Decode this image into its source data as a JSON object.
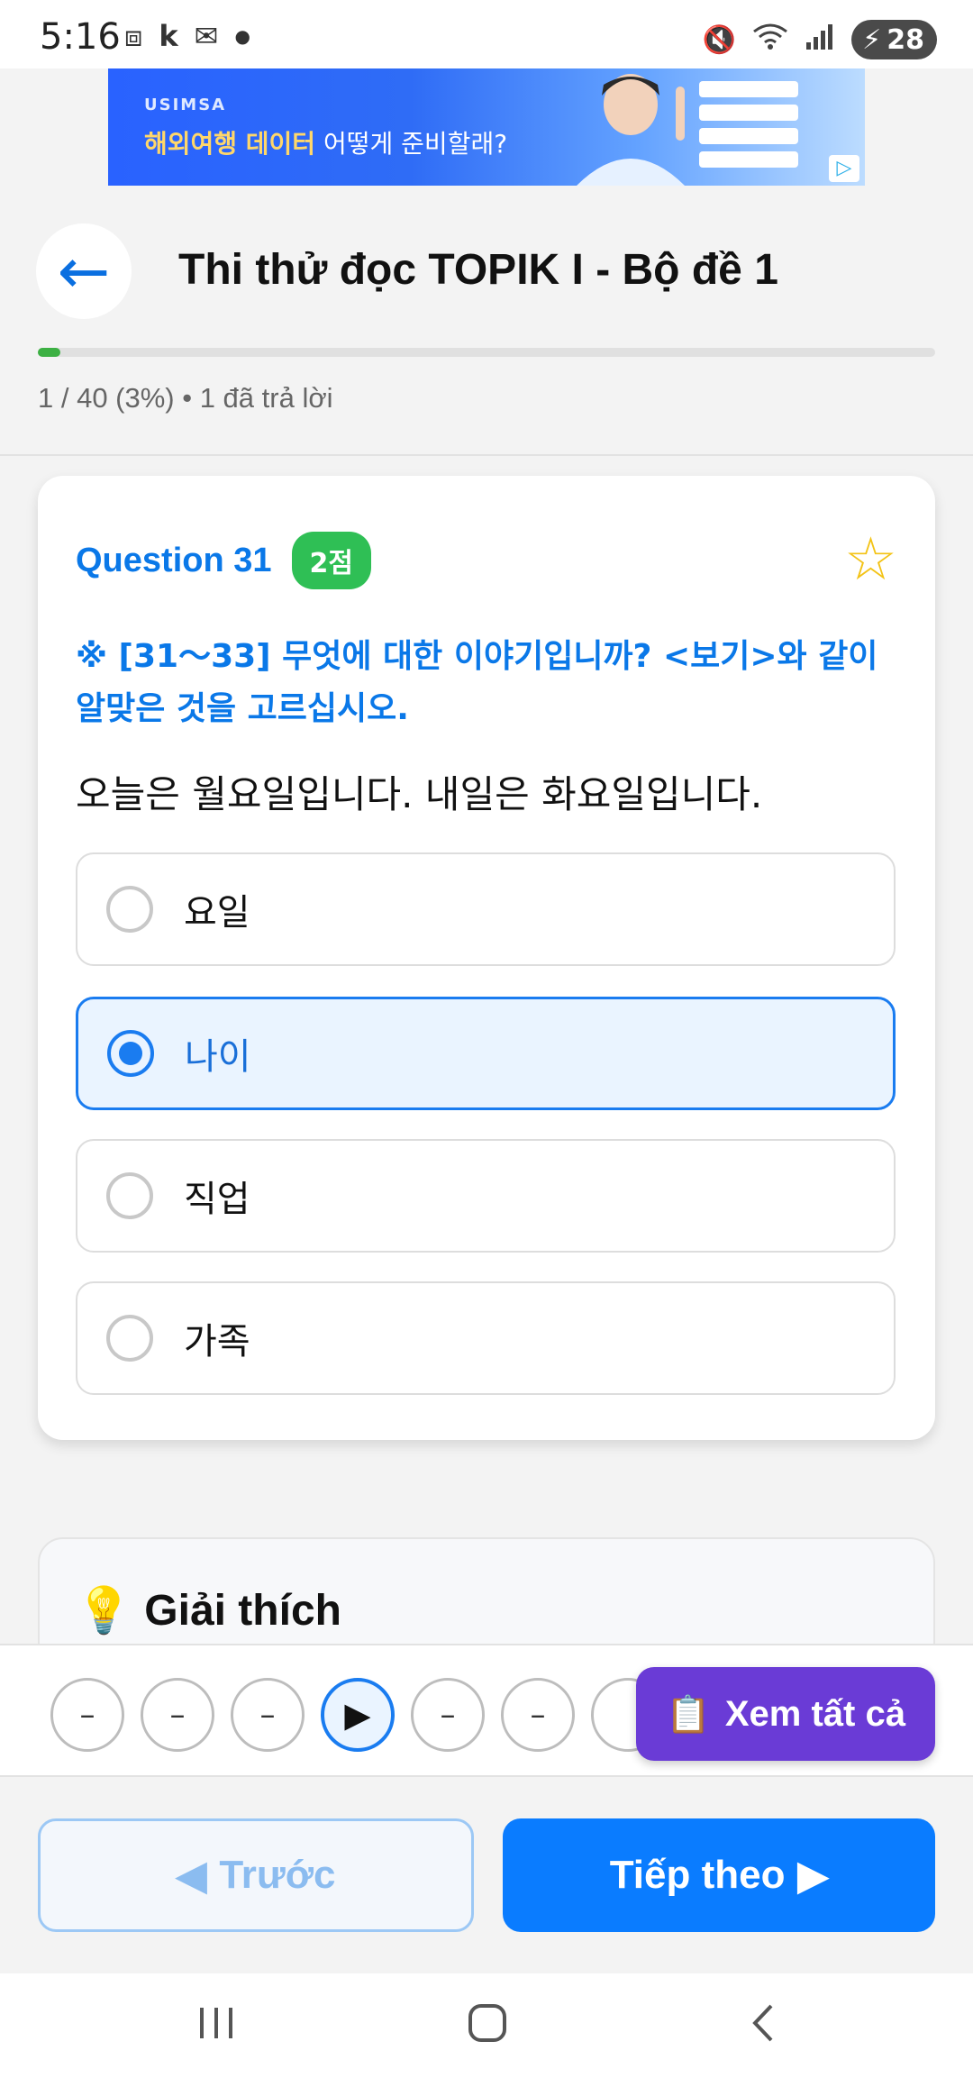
{
  "status_bar": {
    "time": "5:16",
    "left_icons": [
      "screenshot-icon",
      "k-icon",
      "gmail-icon",
      "dot-icon"
    ],
    "battery": "28"
  },
  "ad": {
    "brand": "USIMSA",
    "text_highlight": "해외여행 데이터",
    "text_rest": " 어떻게 준비할래?"
  },
  "header": {
    "back_icon": "arrow-left-icon",
    "title": "Thi thử đọc TOPIK I - Bộ đề 1",
    "progress_fraction": 0.025,
    "progress_text": "1 / 40 (3%) • 1 đã trả lời"
  },
  "question": {
    "label": "Question 31",
    "points": "2점",
    "instruction": "※ [31～33] 무엇에 대한 이야기입니까? <보기>와 같이 알맞은 것을 고르십시오.",
    "passage": "오늘은 월요일입니다. 내일은 화요일입니다.",
    "options": [
      {
        "label": "요일",
        "selected": false
      },
      {
        "label": "나이",
        "selected": true
      },
      {
        "label": "직업",
        "selected": false
      },
      {
        "label": "가족",
        "selected": false
      }
    ]
  },
  "explanation": {
    "title": "Giải thích"
  },
  "navigator": {
    "dots": [
      "–",
      "–",
      "–",
      "▶",
      "–",
      "–"
    ],
    "see_all_label": "Xem tất cả"
  },
  "footer": {
    "prev_label": "Trước",
    "next_label": "Tiếp theo"
  },
  "colors": {
    "accent": "#0a7cff",
    "success": "#2fbf55",
    "purple": "#6a3bd6"
  }
}
